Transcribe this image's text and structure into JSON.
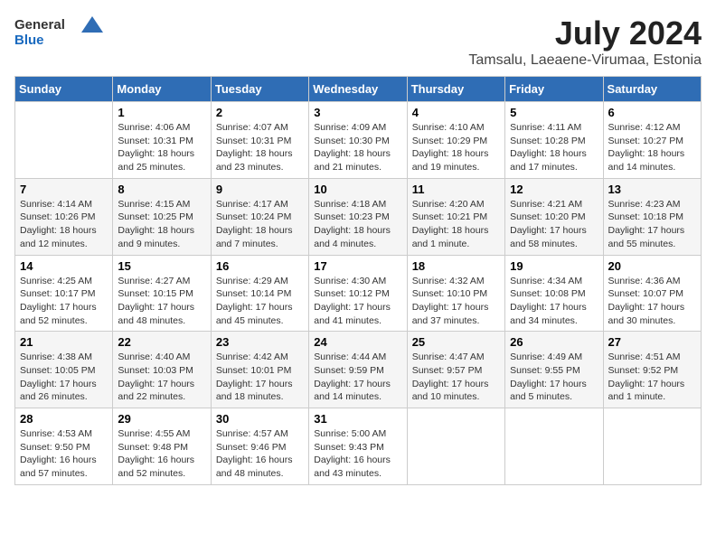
{
  "header": {
    "logo_general": "General",
    "logo_blue": "Blue",
    "main_title": "July 2024",
    "subtitle": "Tamsalu, Laeaene-Virumaa, Estonia"
  },
  "days_of_week": [
    "Sunday",
    "Monday",
    "Tuesday",
    "Wednesday",
    "Thursday",
    "Friday",
    "Saturday"
  ],
  "weeks": [
    [
      {
        "day": "",
        "info": ""
      },
      {
        "day": "1",
        "info": "Sunrise: 4:06 AM\nSunset: 10:31 PM\nDaylight: 18 hours\nand 25 minutes."
      },
      {
        "day": "2",
        "info": "Sunrise: 4:07 AM\nSunset: 10:31 PM\nDaylight: 18 hours\nand 23 minutes."
      },
      {
        "day": "3",
        "info": "Sunrise: 4:09 AM\nSunset: 10:30 PM\nDaylight: 18 hours\nand 21 minutes."
      },
      {
        "day": "4",
        "info": "Sunrise: 4:10 AM\nSunset: 10:29 PM\nDaylight: 18 hours\nand 19 minutes."
      },
      {
        "day": "5",
        "info": "Sunrise: 4:11 AM\nSunset: 10:28 PM\nDaylight: 18 hours\nand 17 minutes."
      },
      {
        "day": "6",
        "info": "Sunrise: 4:12 AM\nSunset: 10:27 PM\nDaylight: 18 hours\nand 14 minutes."
      }
    ],
    [
      {
        "day": "7",
        "info": "Sunrise: 4:14 AM\nSunset: 10:26 PM\nDaylight: 18 hours\nand 12 minutes."
      },
      {
        "day": "8",
        "info": "Sunrise: 4:15 AM\nSunset: 10:25 PM\nDaylight: 18 hours\nand 9 minutes."
      },
      {
        "day": "9",
        "info": "Sunrise: 4:17 AM\nSunset: 10:24 PM\nDaylight: 18 hours\nand 7 minutes."
      },
      {
        "day": "10",
        "info": "Sunrise: 4:18 AM\nSunset: 10:23 PM\nDaylight: 18 hours\nand 4 minutes."
      },
      {
        "day": "11",
        "info": "Sunrise: 4:20 AM\nSunset: 10:21 PM\nDaylight: 18 hours\nand 1 minute."
      },
      {
        "day": "12",
        "info": "Sunrise: 4:21 AM\nSunset: 10:20 PM\nDaylight: 17 hours\nand 58 minutes."
      },
      {
        "day": "13",
        "info": "Sunrise: 4:23 AM\nSunset: 10:18 PM\nDaylight: 17 hours\nand 55 minutes."
      }
    ],
    [
      {
        "day": "14",
        "info": "Sunrise: 4:25 AM\nSunset: 10:17 PM\nDaylight: 17 hours\nand 52 minutes."
      },
      {
        "day": "15",
        "info": "Sunrise: 4:27 AM\nSunset: 10:15 PM\nDaylight: 17 hours\nand 48 minutes."
      },
      {
        "day": "16",
        "info": "Sunrise: 4:29 AM\nSunset: 10:14 PM\nDaylight: 17 hours\nand 45 minutes."
      },
      {
        "day": "17",
        "info": "Sunrise: 4:30 AM\nSunset: 10:12 PM\nDaylight: 17 hours\nand 41 minutes."
      },
      {
        "day": "18",
        "info": "Sunrise: 4:32 AM\nSunset: 10:10 PM\nDaylight: 17 hours\nand 37 minutes."
      },
      {
        "day": "19",
        "info": "Sunrise: 4:34 AM\nSunset: 10:08 PM\nDaylight: 17 hours\nand 34 minutes."
      },
      {
        "day": "20",
        "info": "Sunrise: 4:36 AM\nSunset: 10:07 PM\nDaylight: 17 hours\nand 30 minutes."
      }
    ],
    [
      {
        "day": "21",
        "info": "Sunrise: 4:38 AM\nSunset: 10:05 PM\nDaylight: 17 hours\nand 26 minutes."
      },
      {
        "day": "22",
        "info": "Sunrise: 4:40 AM\nSunset: 10:03 PM\nDaylight: 17 hours\nand 22 minutes."
      },
      {
        "day": "23",
        "info": "Sunrise: 4:42 AM\nSunset: 10:01 PM\nDaylight: 17 hours\nand 18 minutes."
      },
      {
        "day": "24",
        "info": "Sunrise: 4:44 AM\nSunset: 9:59 PM\nDaylight: 17 hours\nand 14 minutes."
      },
      {
        "day": "25",
        "info": "Sunrise: 4:47 AM\nSunset: 9:57 PM\nDaylight: 17 hours\nand 10 minutes."
      },
      {
        "day": "26",
        "info": "Sunrise: 4:49 AM\nSunset: 9:55 PM\nDaylight: 17 hours\nand 5 minutes."
      },
      {
        "day": "27",
        "info": "Sunrise: 4:51 AM\nSunset: 9:52 PM\nDaylight: 17 hours\nand 1 minute."
      }
    ],
    [
      {
        "day": "28",
        "info": "Sunrise: 4:53 AM\nSunset: 9:50 PM\nDaylight: 16 hours\nand 57 minutes."
      },
      {
        "day": "29",
        "info": "Sunrise: 4:55 AM\nSunset: 9:48 PM\nDaylight: 16 hours\nand 52 minutes."
      },
      {
        "day": "30",
        "info": "Sunrise: 4:57 AM\nSunset: 9:46 PM\nDaylight: 16 hours\nand 48 minutes."
      },
      {
        "day": "31",
        "info": "Sunrise: 5:00 AM\nSunset: 9:43 PM\nDaylight: 16 hours\nand 43 minutes."
      },
      {
        "day": "",
        "info": ""
      },
      {
        "day": "",
        "info": ""
      },
      {
        "day": "",
        "info": ""
      }
    ]
  ]
}
